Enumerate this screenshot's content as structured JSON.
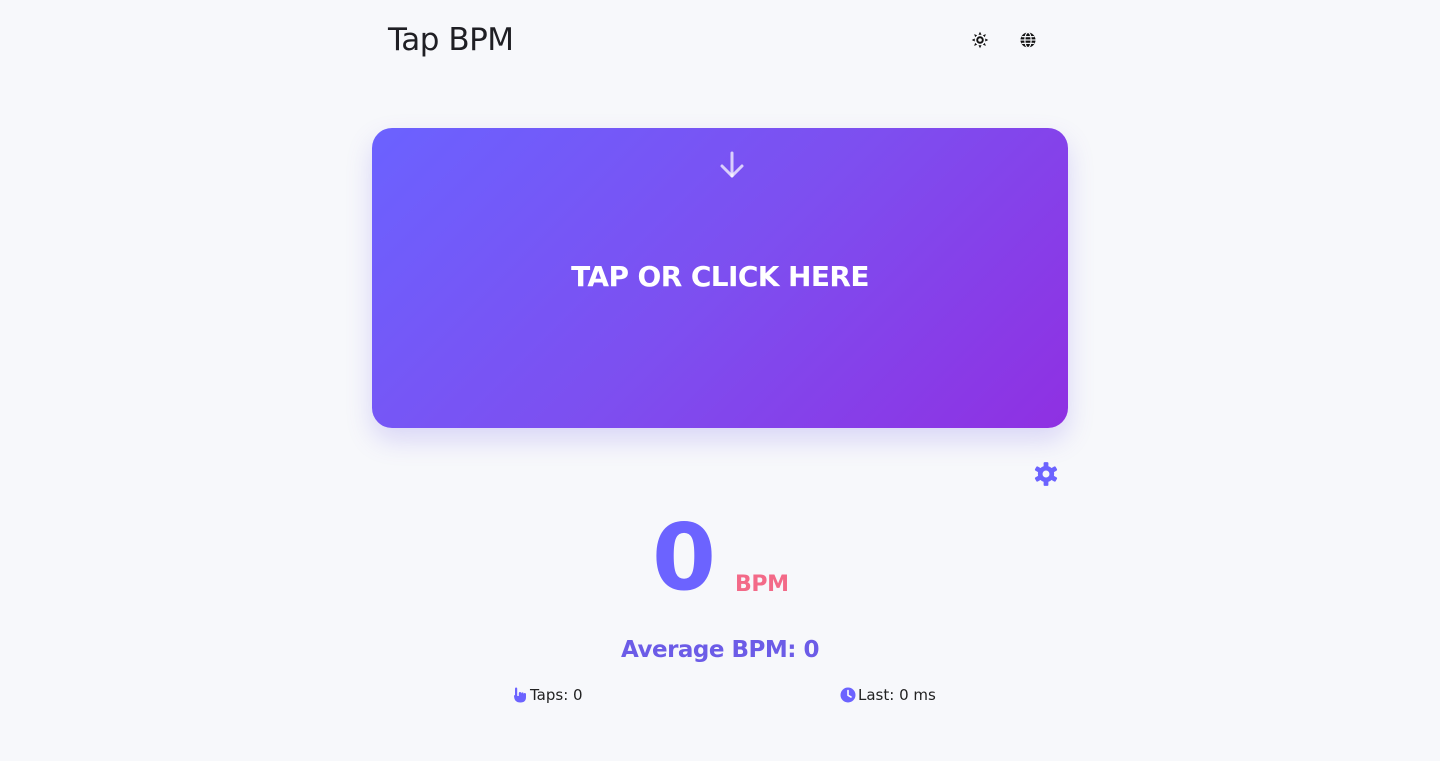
{
  "header": {
    "title": "Tap BPM",
    "theme_icon": "sun-icon",
    "language_icon": "globe-icon"
  },
  "tap_area": {
    "label": "TAP OR CLICK HERE",
    "icon": "arrow-down-icon"
  },
  "settings": {
    "icon": "gear-icon"
  },
  "bpm": {
    "value": "0",
    "unit": "BPM"
  },
  "average": {
    "text": "Average BPM: 0"
  },
  "stats": {
    "taps": "Taps: 0",
    "taps_icon": "hand-icon",
    "last": "Last: 0 ms",
    "last_icon": "clock-icon"
  },
  "colors": {
    "accent": "#6c63ff",
    "gradient_start": "#6b62ff",
    "gradient_end": "#8f30e2",
    "unit": "#f36a88",
    "background": "#f7f8fb"
  }
}
